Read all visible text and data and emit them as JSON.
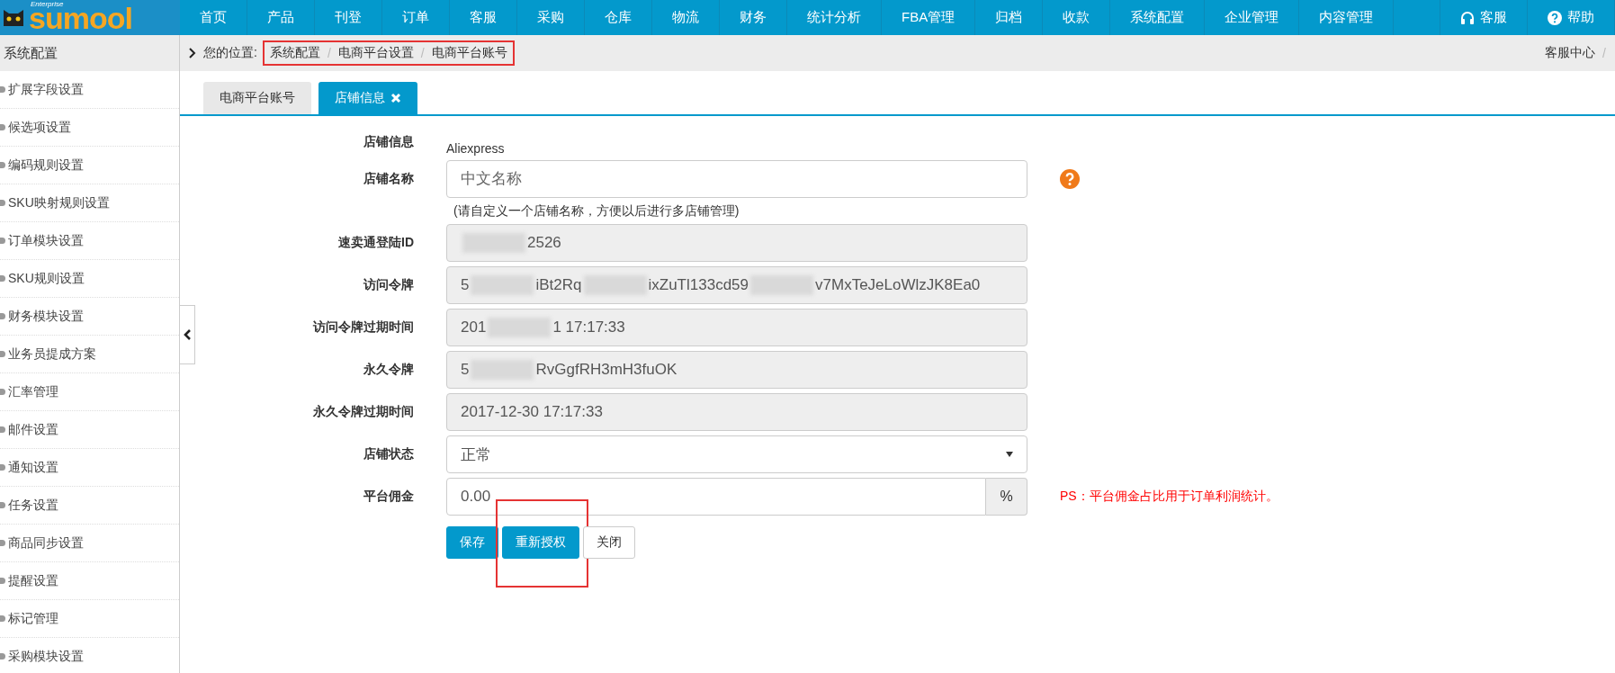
{
  "logo": {
    "text": "sumool",
    "badge": "Enterprise"
  },
  "nav": {
    "items": [
      {
        "label": "首页",
        "selected": false
      },
      {
        "label": "产品",
        "selected": false
      },
      {
        "label": "刊登",
        "selected": false
      },
      {
        "label": "订单",
        "selected": false
      },
      {
        "label": "客服",
        "selected": false
      },
      {
        "label": "采购",
        "selected": false
      },
      {
        "label": "仓库",
        "selected": false
      },
      {
        "label": "物流",
        "selected": false
      },
      {
        "label": "财务",
        "selected": false
      },
      {
        "label": "统计分析",
        "selected": false
      },
      {
        "label": "FBA管理",
        "selected": false
      },
      {
        "label": "归档",
        "selected": false
      },
      {
        "label": "收款",
        "selected": false
      },
      {
        "label": "系统配置",
        "selected": false
      },
      {
        "label": "企业管理",
        "selected": false
      },
      {
        "label": "内容管理",
        "selected": false
      }
    ],
    "right": [
      {
        "kind": "headset",
        "label": "客服"
      },
      {
        "kind": "help",
        "label": "帮助"
      }
    ]
  },
  "sidebar": {
    "title": "系统配置",
    "items": [
      {
        "label": "扩展字段设置"
      },
      {
        "label": "候选项设置"
      },
      {
        "label": "编码规则设置"
      },
      {
        "label": "SKU映射规则设置"
      },
      {
        "label": "订单模块设置"
      },
      {
        "label": "SKU规则设置"
      },
      {
        "label": "财务模块设置"
      },
      {
        "label": "业务员提成方案"
      },
      {
        "label": "汇率管理"
      },
      {
        "label": "邮件设置"
      },
      {
        "label": "通知设置"
      },
      {
        "label": "任务设置"
      },
      {
        "label": "商品同步设置"
      },
      {
        "label": "提醒设置"
      },
      {
        "label": "标记管理"
      },
      {
        "label": "采购模块设置"
      }
    ]
  },
  "breadcrumb": {
    "prefix": "您的位置:",
    "items": [
      "系统配置",
      "电商平台设置",
      "电商平台账号"
    ],
    "separator": "/",
    "right_separator": "/",
    "highlighted": true,
    "right_link": "客服中心"
  },
  "tabs": [
    {
      "label": "电商平台账号",
      "selected": false,
      "closable": false
    },
    {
      "label": "店铺信息",
      "selected": true,
      "closable": true
    }
  ],
  "form": {
    "rows": [
      {
        "kind": "static",
        "label": "店铺信息",
        "value": "Aliexpress"
      },
      {
        "kind": "input",
        "label": "店铺名称",
        "placeholder": "中文名称",
        "hint": "(请自定义一个店铺名称，方便以后进行多店铺管理)",
        "help": true
      },
      {
        "kind": "readonly",
        "label": "速卖通登陆ID",
        "parts": [
          {
            "kind": "redacted"
          },
          {
            "kind": "text",
            "text": "2526"
          }
        ]
      },
      {
        "kind": "readonly",
        "label": "访问令牌",
        "parts": [
          {
            "kind": "text",
            "text": "5"
          },
          {
            "kind": "redacted"
          },
          {
            "kind": "text",
            "text": "iBt2Rq"
          },
          {
            "kind": "redacted"
          },
          {
            "kind": "text",
            "text": "ixZuTl133cd59"
          },
          {
            "kind": "redacted"
          },
          {
            "kind": "text",
            "text": "v7MxTeJeLoWlzJK8Ea0"
          }
        ]
      },
      {
        "kind": "readonly",
        "label": "访问令牌过期时间",
        "parts": [
          {
            "kind": "text",
            "text": "201"
          },
          {
            "kind": "redacted"
          },
          {
            "kind": "text",
            "text": "1 17:17:33"
          }
        ]
      },
      {
        "kind": "readonly",
        "label": "永久令牌",
        "parts": [
          {
            "kind": "text",
            "text": "5"
          },
          {
            "kind": "redacted"
          },
          {
            "kind": "text",
            "text": "RvGgfRH3mH3fuOK"
          }
        ]
      },
      {
        "kind": "readonly",
        "label": "永久令牌过期时间",
        "parts": [
          {
            "kind": "text",
            "text": "2017-12-30 17:17:33"
          }
        ]
      },
      {
        "kind": "select",
        "label": "店铺状态",
        "value": "正常"
      },
      {
        "kind": "addon",
        "label": "平台佣金",
        "value": "0.00",
        "addon": "%",
        "note": "PS：平台佣金占比用于订单利润统计。"
      }
    ],
    "buttons": [
      {
        "label": "保存",
        "kind": "primary",
        "highlighted": false
      },
      {
        "label": "重新授权",
        "kind": "primary",
        "highlighted": true
      },
      {
        "label": "关闭",
        "kind": "default",
        "highlighted": false
      }
    ]
  }
}
